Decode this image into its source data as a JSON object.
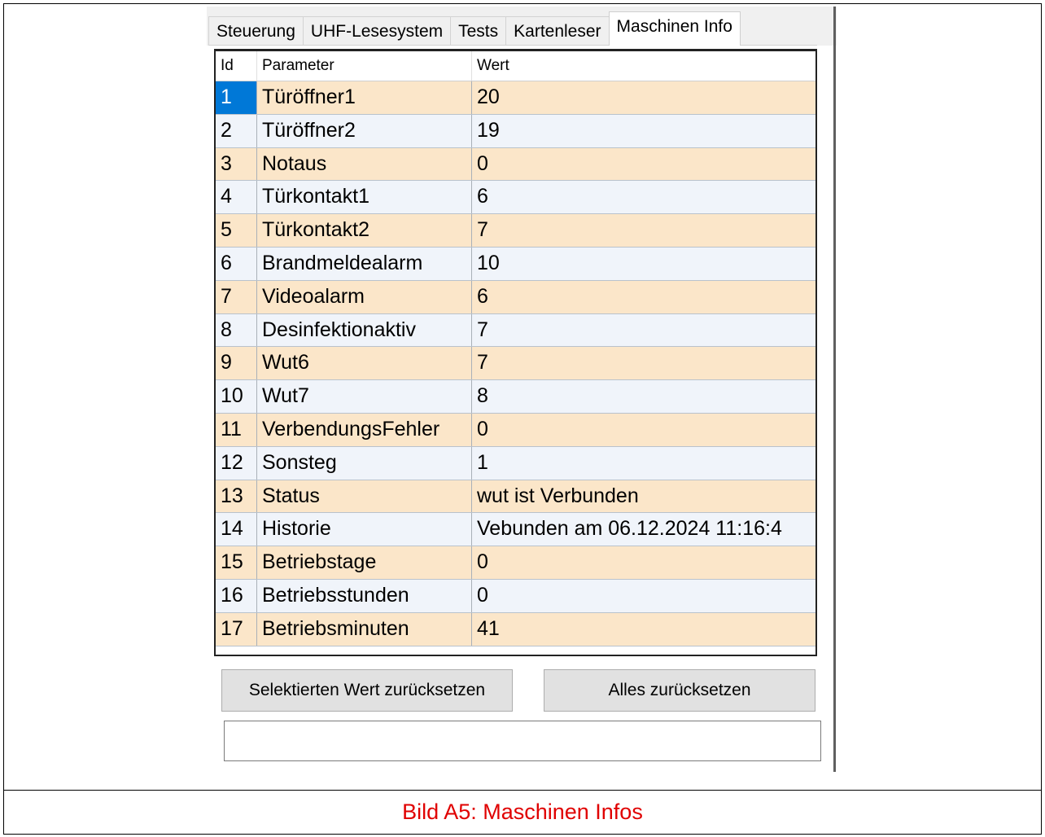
{
  "tabs": [
    {
      "label": "Steuerung",
      "active": false
    },
    {
      "label": "UHF-Lesesystem",
      "active": false
    },
    {
      "label": "Tests",
      "active": false
    },
    {
      "label": "Kartenleser",
      "active": false
    },
    {
      "label": "Maschinen Info",
      "active": true
    }
  ],
  "grid": {
    "columns": {
      "id": "Id",
      "param": "Parameter",
      "value": "Wert"
    },
    "selected_row": 1,
    "rows": [
      {
        "id": "1",
        "param": "Türöffner1",
        "value": "20"
      },
      {
        "id": "2",
        "param": "Türöffner2",
        "value": "19"
      },
      {
        "id": "3",
        "param": "Notaus",
        "value": "0"
      },
      {
        "id": "4",
        "param": "Türkontakt1",
        "value": "6"
      },
      {
        "id": "5",
        "param": "Türkontakt2",
        "value": "7"
      },
      {
        "id": "6",
        "param": "Brandmeldealarm",
        "value": "10"
      },
      {
        "id": "7",
        "param": "Videoalarm",
        "value": "6"
      },
      {
        "id": "8",
        "param": "Desinfektionaktiv",
        "value": "7"
      },
      {
        "id": "9",
        "param": "Wut6",
        "value": "7"
      },
      {
        "id": "10",
        "param": "Wut7",
        "value": "8"
      },
      {
        "id": "11",
        "param": "VerbendungsFehler",
        "value": "0"
      },
      {
        "id": "12",
        "param": "Sonsteg",
        "value": "1"
      },
      {
        "id": "13",
        "param": "Status",
        "value": "wut ist Verbunden"
      },
      {
        "id": "14",
        "param": "Historie",
        "value": "Vebunden am  06.12.2024 11:16:4"
      },
      {
        "id": "15",
        "param": "Betriebstage",
        "value": "0"
      },
      {
        "id": "16",
        "param": "Betriebsstunden",
        "value": "0"
      },
      {
        "id": "17",
        "param": "Betriebsminuten",
        "value": "41"
      }
    ]
  },
  "buttons": {
    "reset_selected": "Selektierten Wert zurücksetzen",
    "reset_all": "Alles zurücksetzen"
  },
  "status_box": {
    "value": ""
  },
  "caption": "Bild A5: Maschinen Infos",
  "colors": {
    "row_odd": "#fbe6c9",
    "row_even": "#f0f4fa",
    "selection": "#0078d7",
    "caption": "#e00000"
  }
}
